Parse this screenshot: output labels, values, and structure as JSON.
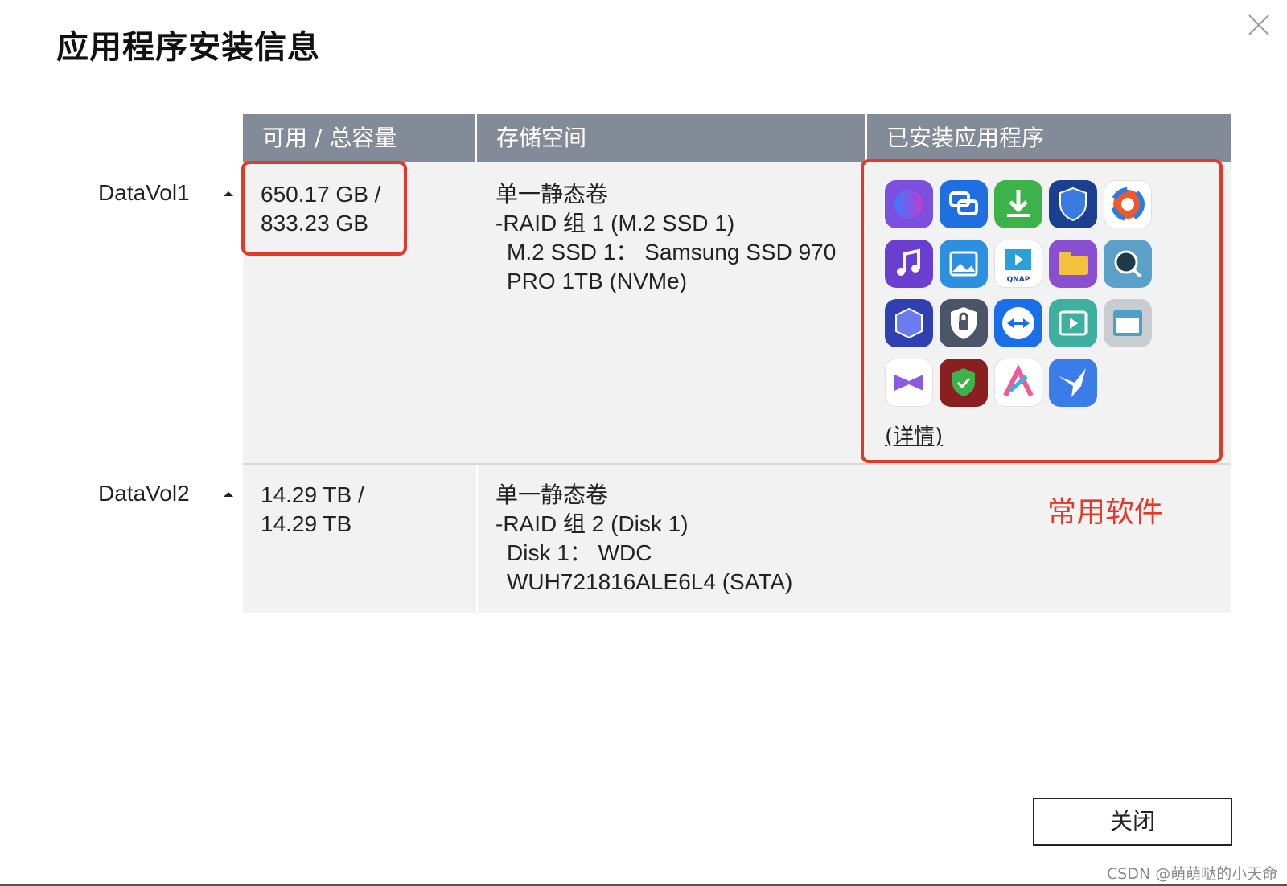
{
  "dialog": {
    "title": "应用程序安装信息",
    "close_button_label": "关闭",
    "watermark": "CSDN @萌萌哒的小天命"
  },
  "table": {
    "headers": [
      "可用 / 总容量",
      "存储空间",
      "已安装应用程序"
    ],
    "rows": [
      {
        "volume": "DataVol1",
        "capacity": [
          "650.17 GB /",
          "833.23 GB"
        ],
        "storage": [
          "单一静态卷",
          "-RAID 组 1 (M.2 SSD 1)",
          "M.2 SSD 1：  Samsung SSD 970",
          "PRO 1TB (NVMe)"
        ],
        "apps_details_link": "(详情)"
      },
      {
        "volume": "DataVol2",
        "capacity": [
          "14.29 TB /",
          "14.29 TB"
        ],
        "storage": [
          "单一静态卷",
          "-RAID 组 2 (Disk 1)",
          "Disk 1：  WDC",
          "WUH721816ALE6L4 (SATA)"
        ]
      }
    ]
  },
  "annotation": "常用软件",
  "apps": [
    {
      "icon": "swirl-app-icon",
      "color": "#7b4fe0"
    },
    {
      "icon": "link-cloud-app-icon",
      "color": "#1f6fe0"
    },
    {
      "icon": "download-station-icon",
      "color": "#3bb34a"
    },
    {
      "icon": "security-shield-icon",
      "color": "#1c3f8f"
    },
    {
      "icon": "aperture-app-icon",
      "color": "#ffffff"
    },
    {
      "icon": "music-station-icon",
      "color": "#6a3fcf"
    },
    {
      "icon": "photo-station-icon",
      "color": "#2d8fe0"
    },
    {
      "icon": "qnap-media-icon",
      "color": "#ffffff"
    },
    {
      "icon": "file-station-icon",
      "color": "#8a4fd0"
    },
    {
      "icon": "search-app-icon",
      "color": "#5aa0c8"
    },
    {
      "icon": "cube-app-icon",
      "color": "#3040b0"
    },
    {
      "icon": "lock-badge-icon",
      "color": "#4a5568"
    },
    {
      "icon": "teamviewer-icon",
      "color": "#1a6fe8"
    },
    {
      "icon": "video-station-icon",
      "color": "#3fb0a0"
    },
    {
      "icon": "web-server-icon",
      "color": "#c9ccd1"
    },
    {
      "icon": "bow-app-icon",
      "color": "#ffffff"
    },
    {
      "icon": "firewall-icon",
      "color": "#8a1f22"
    },
    {
      "icon": "ai-app-icon",
      "color": "#ffffff"
    },
    {
      "icon": "bird-app-icon",
      "color": "#3b7de8"
    }
  ]
}
